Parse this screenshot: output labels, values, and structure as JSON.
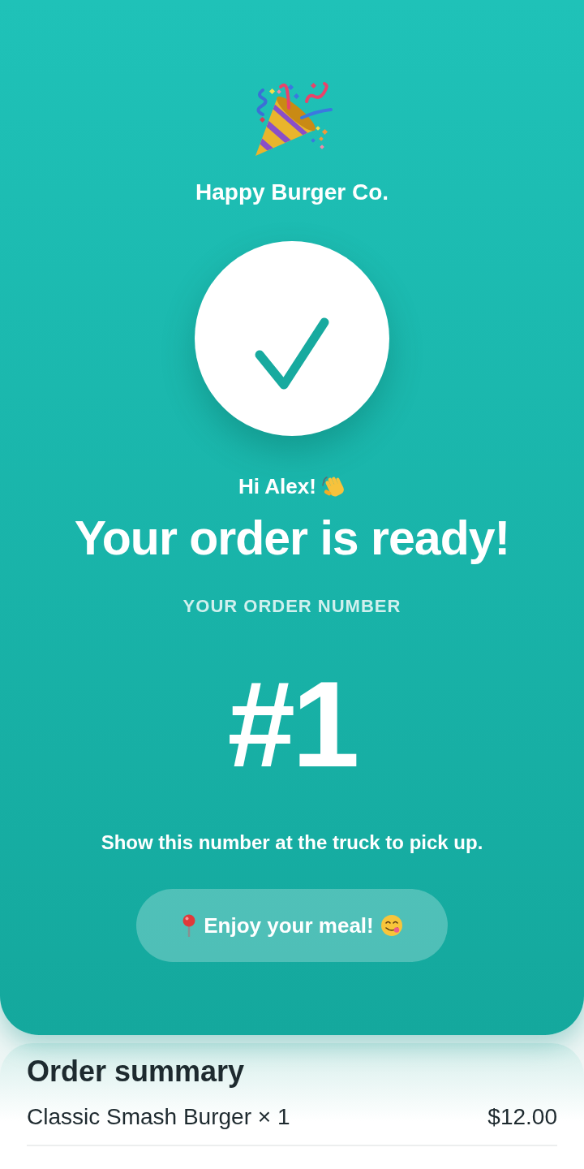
{
  "header": {
    "brand": "Happy Burger Co."
  },
  "confirmation": {
    "greeting": "Hi Alex!",
    "headline": "Your order is ready!",
    "number_label": "YOUR ORDER NUMBER",
    "order_number": "#1",
    "instruction": "Show this number at the truck to pick up.",
    "button": "Enjoy your meal!"
  },
  "summary": {
    "title": "Order summary",
    "items": [
      {
        "name": "Classic Smash Burger × 1",
        "price": "$12.00"
      }
    ]
  }
}
